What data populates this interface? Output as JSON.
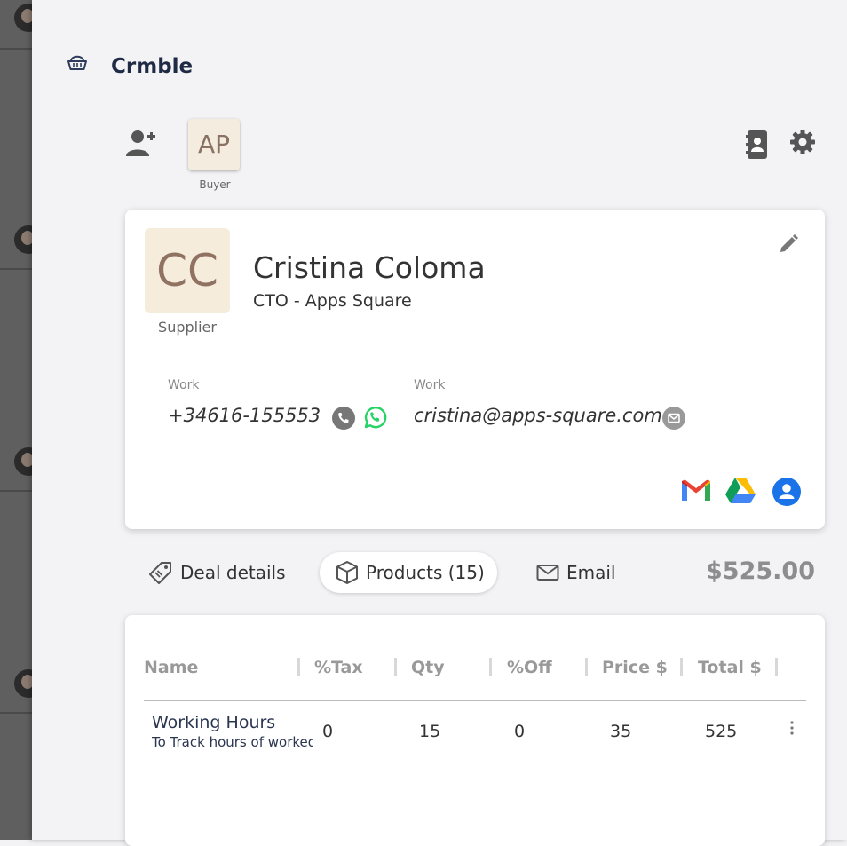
{
  "app": {
    "title": "Crmble"
  },
  "participant": {
    "initials": "AP",
    "role": "Buyer"
  },
  "contact": {
    "initials": "CC",
    "role": "Supplier",
    "name": "Cristina Coloma",
    "subtitle": "CTO - Apps Square",
    "phone": {
      "label": "Work",
      "value": "+34616-155553"
    },
    "email": {
      "label": "Work",
      "value": "cristina@apps-square.com"
    }
  },
  "tabs": [
    {
      "label": "Deal details",
      "icon": "tag-icon"
    },
    {
      "label": "Products (15)",
      "icon": "box-icon",
      "active": true
    },
    {
      "label": "Email",
      "icon": "envelope-icon"
    }
  ],
  "deal_amount": "$525.00",
  "products": {
    "columns": [
      "Name",
      "%Tax",
      "Qty",
      "%Off",
      "Price $",
      "Total $"
    ],
    "rows": [
      {
        "name": "Working Hours",
        "description": "To Track hours of worked",
        "tax": "0",
        "qty": "15",
        "off": "0",
        "price": "35",
        "total": "525"
      }
    ]
  },
  "colors": {
    "accent_dark": "#1f2a44",
    "whatsapp": "#25d366",
    "muted": "#8d8d8d"
  }
}
